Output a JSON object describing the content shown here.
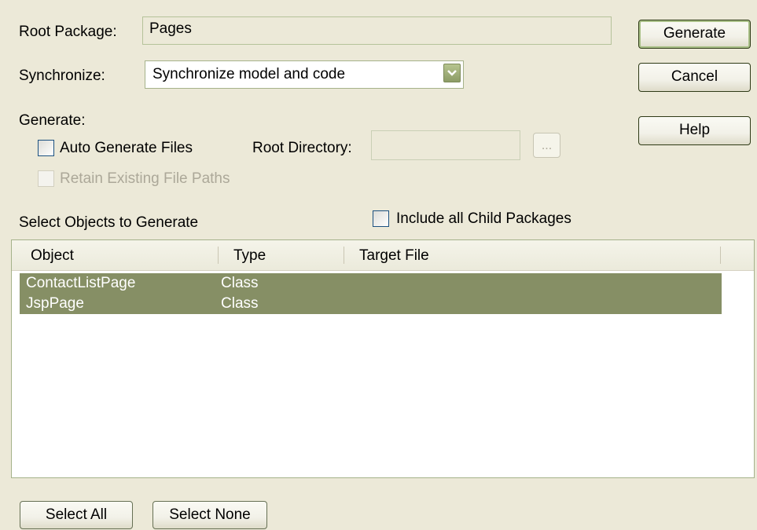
{
  "root_package": {
    "label": "Root Package:",
    "value": "Pages"
  },
  "synchronize": {
    "label": "Synchronize:",
    "value": "Synchronize model and code"
  },
  "generate_section": {
    "label": "Generate:",
    "auto_generate": {
      "label": "Auto Generate Files",
      "checked": false
    },
    "root_directory": {
      "label": "Root Directory:",
      "value": "",
      "browse_label": "..."
    },
    "retain_paths": {
      "label": "Retain Existing File Paths",
      "checked": false,
      "enabled": false
    }
  },
  "select_objects": {
    "label": "Select Objects to Generate",
    "include_children": {
      "label": "Include all Child Packages",
      "checked": false
    }
  },
  "objects_table": {
    "columns": [
      "Object",
      "Type",
      "Target File"
    ],
    "rows": [
      {
        "object": "ContactListPage",
        "type": "Class",
        "target": "",
        "selected": true
      },
      {
        "object": "JspPage",
        "type": "Class",
        "target": "",
        "selected": true
      }
    ]
  },
  "buttons": {
    "generate": "Generate",
    "cancel": "Cancel",
    "help": "Help",
    "select_all": "Select All",
    "select_none": "Select None"
  },
  "colors": {
    "dialog_bg": "#ece9d8",
    "selection_bg": "#868f65",
    "border_olive": "#a5b28a"
  }
}
